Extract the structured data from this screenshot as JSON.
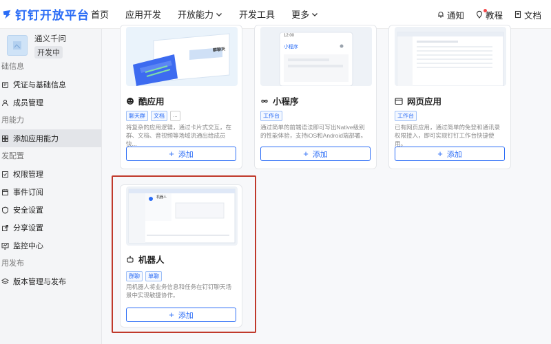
{
  "header": {
    "logo_text": "钉钉开放平台",
    "nav": [
      {
        "label": "首页",
        "has_dropdown": false
      },
      {
        "label": "应用开发",
        "has_dropdown": false
      },
      {
        "label": "开放能力",
        "has_dropdown": true
      },
      {
        "label": "开发工具",
        "has_dropdown": false
      },
      {
        "label": "更多",
        "has_dropdown": true
      }
    ],
    "right": {
      "notify": "通知",
      "tutorial": "教程",
      "docs": "文档"
    }
  },
  "sidebar": {
    "app_name": "通义千问",
    "app_status": "开发中",
    "sections": [
      {
        "title": "础信息",
        "items": [
          {
            "label": "凭证与基础信息",
            "icon": "key-icon"
          },
          {
            "label": "成员管理",
            "icon": "member-icon"
          }
        ]
      },
      {
        "title": "用能力",
        "items": [
          {
            "label": "添加应用能力",
            "icon": "puzzle-icon",
            "active": true
          }
        ]
      },
      {
        "title": "发配置",
        "items": [
          {
            "label": "权限管理",
            "icon": "permission-icon"
          },
          {
            "label": "事件订阅",
            "icon": "event-icon"
          },
          {
            "label": "安全设置",
            "icon": "shield-icon"
          },
          {
            "label": "分享设置",
            "icon": "share-icon"
          },
          {
            "label": "监控中心",
            "icon": "monitor-icon"
          }
        ]
      },
      {
        "title": "用发布",
        "items": [
          {
            "label": "版本管理与发布",
            "icon": "version-icon"
          }
        ]
      }
    ]
  },
  "cards": [
    {
      "title": "酷应用",
      "tags": [
        "聊天群",
        "文档",
        "..."
      ],
      "desc": "将复杂的应用逻辑，通过卡片式交互，在群、文档、音视频等场域流通出给成员快..."
    },
    {
      "title": "小程序",
      "tags": [
        "工作台"
      ],
      "desc": "通过简单的前端语法即可写出Native级别的性能体验，支持iOS和Android端部署。"
    },
    {
      "title": "网页应用",
      "tags": [
        "工作台"
      ],
      "desc": "已有网页应用，通过简单的免登和通讯录权限接入，即可实现钉钉工作台快捷使用。"
    },
    {
      "title": "机器人",
      "tags": [
        "群聊",
        "单聊"
      ],
      "desc": "用机器人将业务信息和任务在钉钉聊天场景中实现敏捷协作。"
    }
  ],
  "add_label": "添加",
  "mockups": {
    "coolapp_thumb_text": "群聊天",
    "miniprogram_time": "12:00",
    "miniprogram_title": "小程序",
    "robot_thumb_text": "机器人"
  },
  "colors": {
    "brand": "#2a6cf6",
    "highlight": "#c0392b"
  }
}
